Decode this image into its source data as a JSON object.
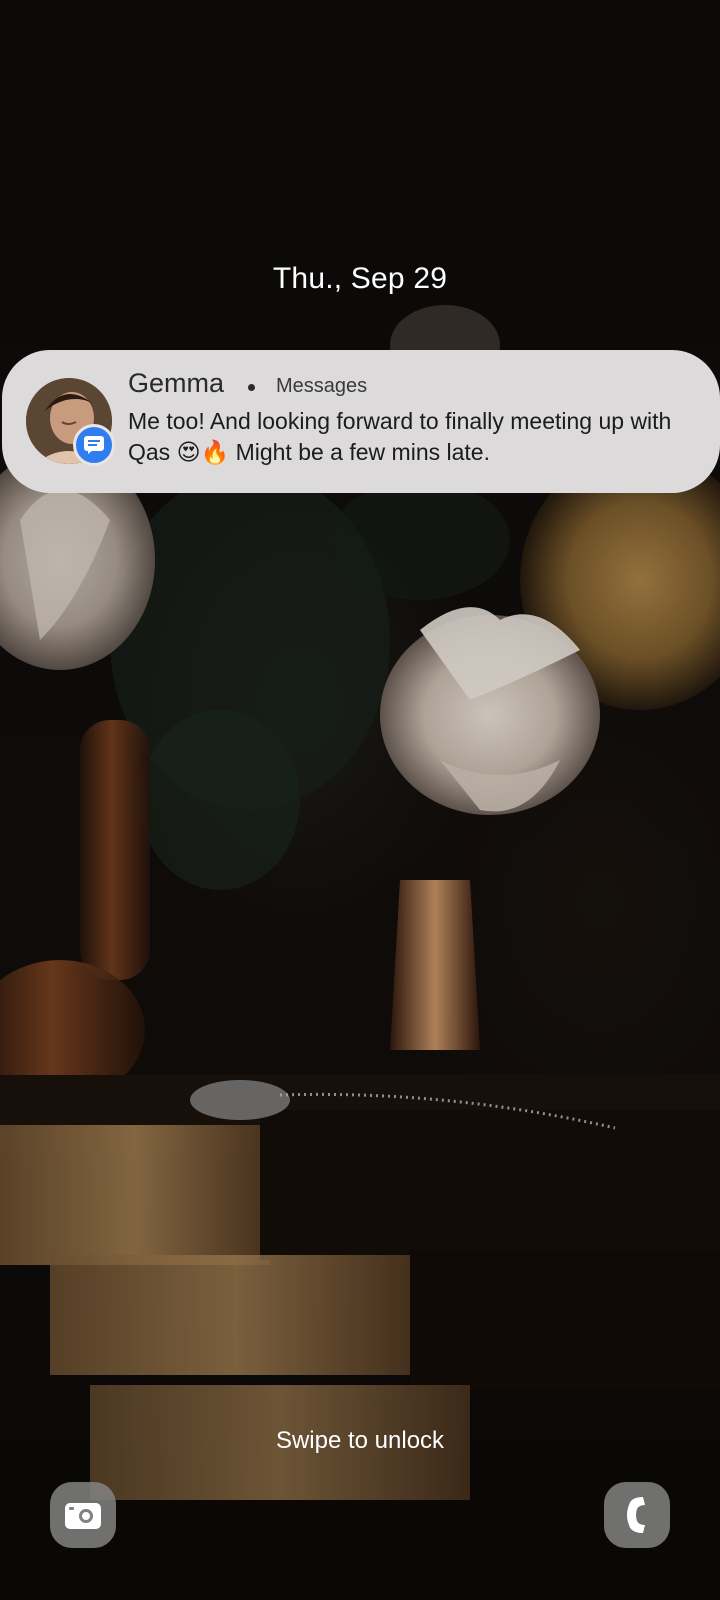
{
  "lockscreen": {
    "date": "Thu., Sep 29",
    "swipe_hint": "Swipe to unlock"
  },
  "notification": {
    "sender": "Gemma",
    "app": "Messages",
    "message": "Me too! And looking forward to finally meeting up with Qas 😍🔥 Might be a few mins late.",
    "avatar_icon": "contact-photo",
    "badge_icon": "messages-app-icon",
    "badge_color": "#2f7ef0"
  },
  "shortcuts": {
    "left_icon": "camera-icon",
    "right_icon": "phone-icon"
  },
  "colors": {
    "notification_bg": "#dcdadb",
    "text_on_wallpaper": "#ffffff"
  }
}
